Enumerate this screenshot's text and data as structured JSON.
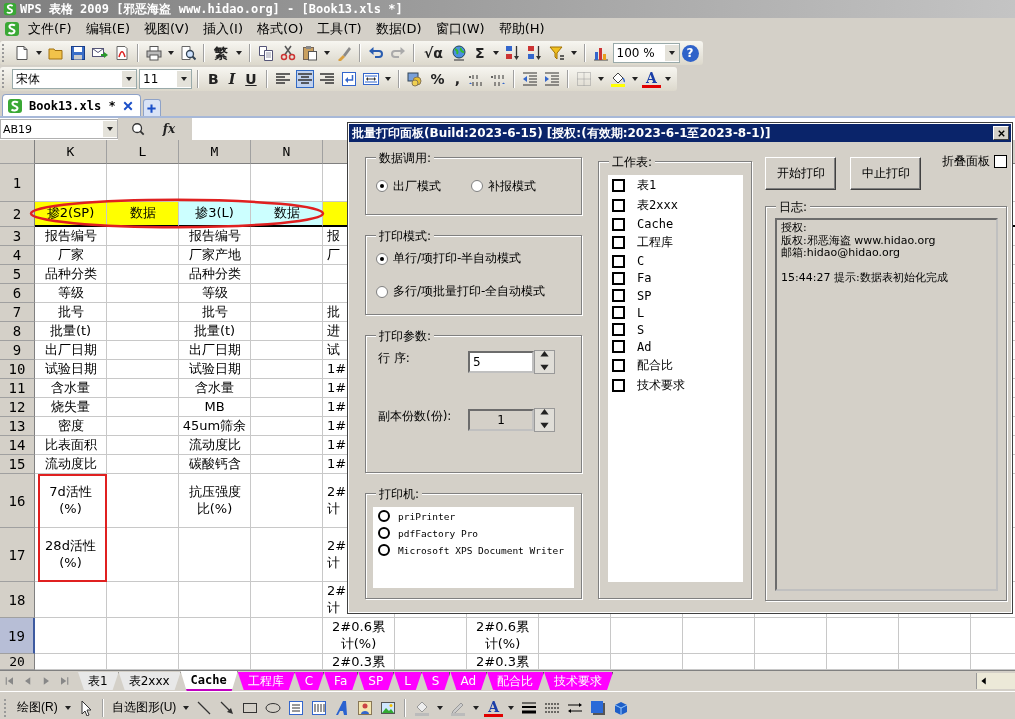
{
  "window": {
    "title": "WPS 表格 2009 [邪恶海盗 www.hidao.org] - [Book13.xls *]"
  },
  "menu": [
    "文件(F)",
    "编辑(E)",
    "视图(V)",
    "插入(I)",
    "格式(O)",
    "工具(T)",
    "数据(D)",
    "窗口(W)",
    "帮助(H)"
  ],
  "standard_toolbar": {
    "glyphs": [
      "繁",
      "√α",
      "Σ",
      "?"
    ],
    "zoom": "100 %"
  },
  "formatting_toolbar": {
    "font": "宋体",
    "size": "11",
    "glyphs": [
      "B",
      "I",
      "U",
      "%",
      ",",
      "A"
    ],
    "align": [
      {
        "selected": false
      },
      {
        "selected": true
      },
      {
        "selected": false
      }
    ]
  },
  "document_tabs": [
    {
      "label": "Book13.xls *",
      "selected": true
    }
  ],
  "formula_bar": {
    "cell": "AB19",
    "fx": "fx"
  },
  "sheet": {
    "columns": [
      "K",
      "L",
      "M",
      "N"
    ],
    "rows": [
      {
        "header": "1",
        "selected": false
      },
      {
        "header": "2",
        "selected": false,
        "cells": [
          {
            "text": "掺2(SP)",
            "color": "#ffff00"
          },
          {
            "text": "数据",
            "color": "#ffff00"
          },
          {
            "text": "掺3(L)",
            "color": "#ccffff"
          },
          {
            "text": "数据",
            "color": "#ccffff"
          },
          {
            "color": "#ffff00"
          }
        ]
      },
      {
        "header": "3",
        "selected": false,
        "cells": [
          "报告编号",
          null,
          "报告编号",
          null,
          "报"
        ]
      },
      {
        "header": "4",
        "selected": false,
        "cells": [
          "厂家",
          null,
          "厂家产地",
          null,
          "厂"
        ]
      },
      {
        "header": "5",
        "selected": false,
        "cells": [
          "品种分类",
          null,
          "品种分类"
        ]
      },
      {
        "header": "6",
        "selected": false,
        "cells": [
          "等级",
          null,
          "等级"
        ]
      },
      {
        "header": "7",
        "selected": false,
        "cells": [
          "批号",
          null,
          "批号",
          null,
          "批"
        ]
      },
      {
        "header": "8",
        "selected": false,
        "cells": [
          "批量(t)",
          null,
          "批量(t)",
          null,
          "进"
        ]
      },
      {
        "header": "9",
        "selected": false,
        "cells": [
          "出厂日期",
          null,
          "出厂日期",
          null,
          "试"
        ]
      },
      {
        "header": "10",
        "selected": false,
        "cells": [
          "试验日期",
          null,
          "试验日期",
          null,
          "1#"
        ]
      },
      {
        "header": "11",
        "selected": false,
        "cells": [
          "含水量",
          null,
          "含水量",
          null,
          "1#"
        ]
      },
      {
        "header": "12",
        "selected": false,
        "cells": [
          "烧失量",
          null,
          "MB",
          null,
          "1#"
        ]
      },
      {
        "header": "13",
        "selected": false,
        "cells": [
          "密度",
          null,
          "45um筛余",
          null,
          "1#"
        ]
      },
      {
        "header": "14",
        "selected": false,
        "cells": [
          "比表面积",
          null,
          "流动度比",
          null,
          "1#"
        ]
      },
      {
        "header": "15",
        "selected": false,
        "cells": [
          "流动度比",
          null,
          "碳酸钙含",
          null,
          "1#"
        ]
      },
      {
        "header": "16",
        "selected": false,
        "cells": [
          "7d活性(%)",
          null,
          "抗压强度比(%)",
          null,
          "2#计"
        ]
      },
      {
        "header": "17",
        "selected": false,
        "cells": [
          "28d活性(%)",
          null,
          null,
          null,
          "2#计"
        ]
      },
      {
        "header": "18",
        "selected": false,
        "cells": [
          null,
          null,
          null,
          null,
          "2#计"
        ]
      },
      {
        "header": "19",
        "selected": true,
        "cells": [
          null,
          null,
          null,
          null,
          "2#0.6累计(%)",
          null,
          "2#0.6累计(%)"
        ]
      },
      {
        "header": "20",
        "selected": false,
        "cells": [
          null,
          null,
          null,
          null,
          "2#0.3累",
          null,
          "2#0.3累"
        ]
      }
    ]
  },
  "annotations": [
    {
      "kind": "ellipse"
    },
    {
      "kind": "rectangle"
    }
  ],
  "sheet_tabs": [
    {
      "label": "表1",
      "selected": false
    },
    {
      "label": "表2xxx",
      "selected": false
    },
    {
      "label": "Cache",
      "selected": true
    },
    {
      "label": "工程库",
      "selected": false,
      "color": "#ff00ff"
    },
    {
      "label": "C",
      "selected": false,
      "color": "#ff00ff"
    },
    {
      "label": "Fa",
      "selected": false,
      "color": "#ff00ff"
    },
    {
      "label": "SP",
      "selected": false,
      "color": "#ff00ff"
    },
    {
      "label": "L",
      "selected": false,
      "color": "#ff00ff"
    },
    {
      "label": "S",
      "selected": false,
      "color": "#ff00ff"
    },
    {
      "label": "Ad",
      "selected": false,
      "color": "#ff00ff"
    },
    {
      "label": "配合比",
      "selected": false,
      "color": "#ff00ff"
    },
    {
      "label": "技术要求",
      "selected": false,
      "color": "#ff00ff"
    }
  ],
  "drawing_toolbar": {
    "draw": "绘图(R)",
    "autoshapes": "自选图形(U)",
    "glyphs": [
      "A"
    ]
  },
  "print_panel": {
    "title": "批量打印面板(Build:2023-6-15) [授权:(有效期:2023-6-1至2023-8-1)]",
    "data_source": {
      "label": "数据调用:",
      "options": [
        {
          "label": "出厂模式",
          "selected": true
        },
        {
          "label": "补报模式",
          "selected": false
        }
      ]
    },
    "print_mode": {
      "label": "打印模式:",
      "options": [
        {
          "label": "单行/项打印-半自动模式",
          "selected": true
        },
        {
          "label": "多行/项批量打印-全自动模式",
          "selected": false
        }
      ]
    },
    "print_params": {
      "label": "打印参数:",
      "fields": [
        {
          "label": "行 序:",
          "value": "5",
          "disabled": false
        },
        {
          "label": "副本份数(份):",
          "value": "1",
          "disabled": true
        }
      ]
    },
    "printers": {
      "label": "打印机:",
      "options": [
        {
          "label": "priPrinter",
          "selected": false
        },
        {
          "label": "pdfFactory Pro",
          "selected": false
        },
        {
          "label": "Microsoft XPS Document Writer",
          "selected": false
        }
      ]
    },
    "sheets": {
      "label": "工作表:",
      "items": [
        {
          "label": "表1",
          "checked": false
        },
        {
          "label": "表2xxx",
          "checked": false
        },
        {
          "label": "Cache",
          "checked": false
        },
        {
          "label": "工程库",
          "checked": false
        },
        {
          "label": "C",
          "checked": false
        },
        {
          "label": "Fa",
          "checked": false
        },
        {
          "label": "SP",
          "checked": false
        },
        {
          "label": "L",
          "checked": false
        },
        {
          "label": "S",
          "checked": false
        },
        {
          "label": "Ad",
          "checked": false
        },
        {
          "label": "配合比",
          "checked": false
        },
        {
          "label": "技术要求",
          "checked": false
        }
      ]
    },
    "buttons": [
      "开始打印",
      "中止打印"
    ],
    "collapse": {
      "label": "折叠面板",
      "checked": false
    },
    "log": {
      "label": "日志:",
      "lines": [
        {
          "kind": "info",
          "text": "授权:"
        },
        {
          "kind": "info",
          "text": "版权:邪恶海盗 www.hidao.org"
        },
        {
          "kind": "info",
          "text": "邮箱:hidao@hidao.org"
        },
        {
          "kind": "event",
          "text": "15:44:27 提示:数据表初始化完成"
        }
      ]
    }
  }
}
